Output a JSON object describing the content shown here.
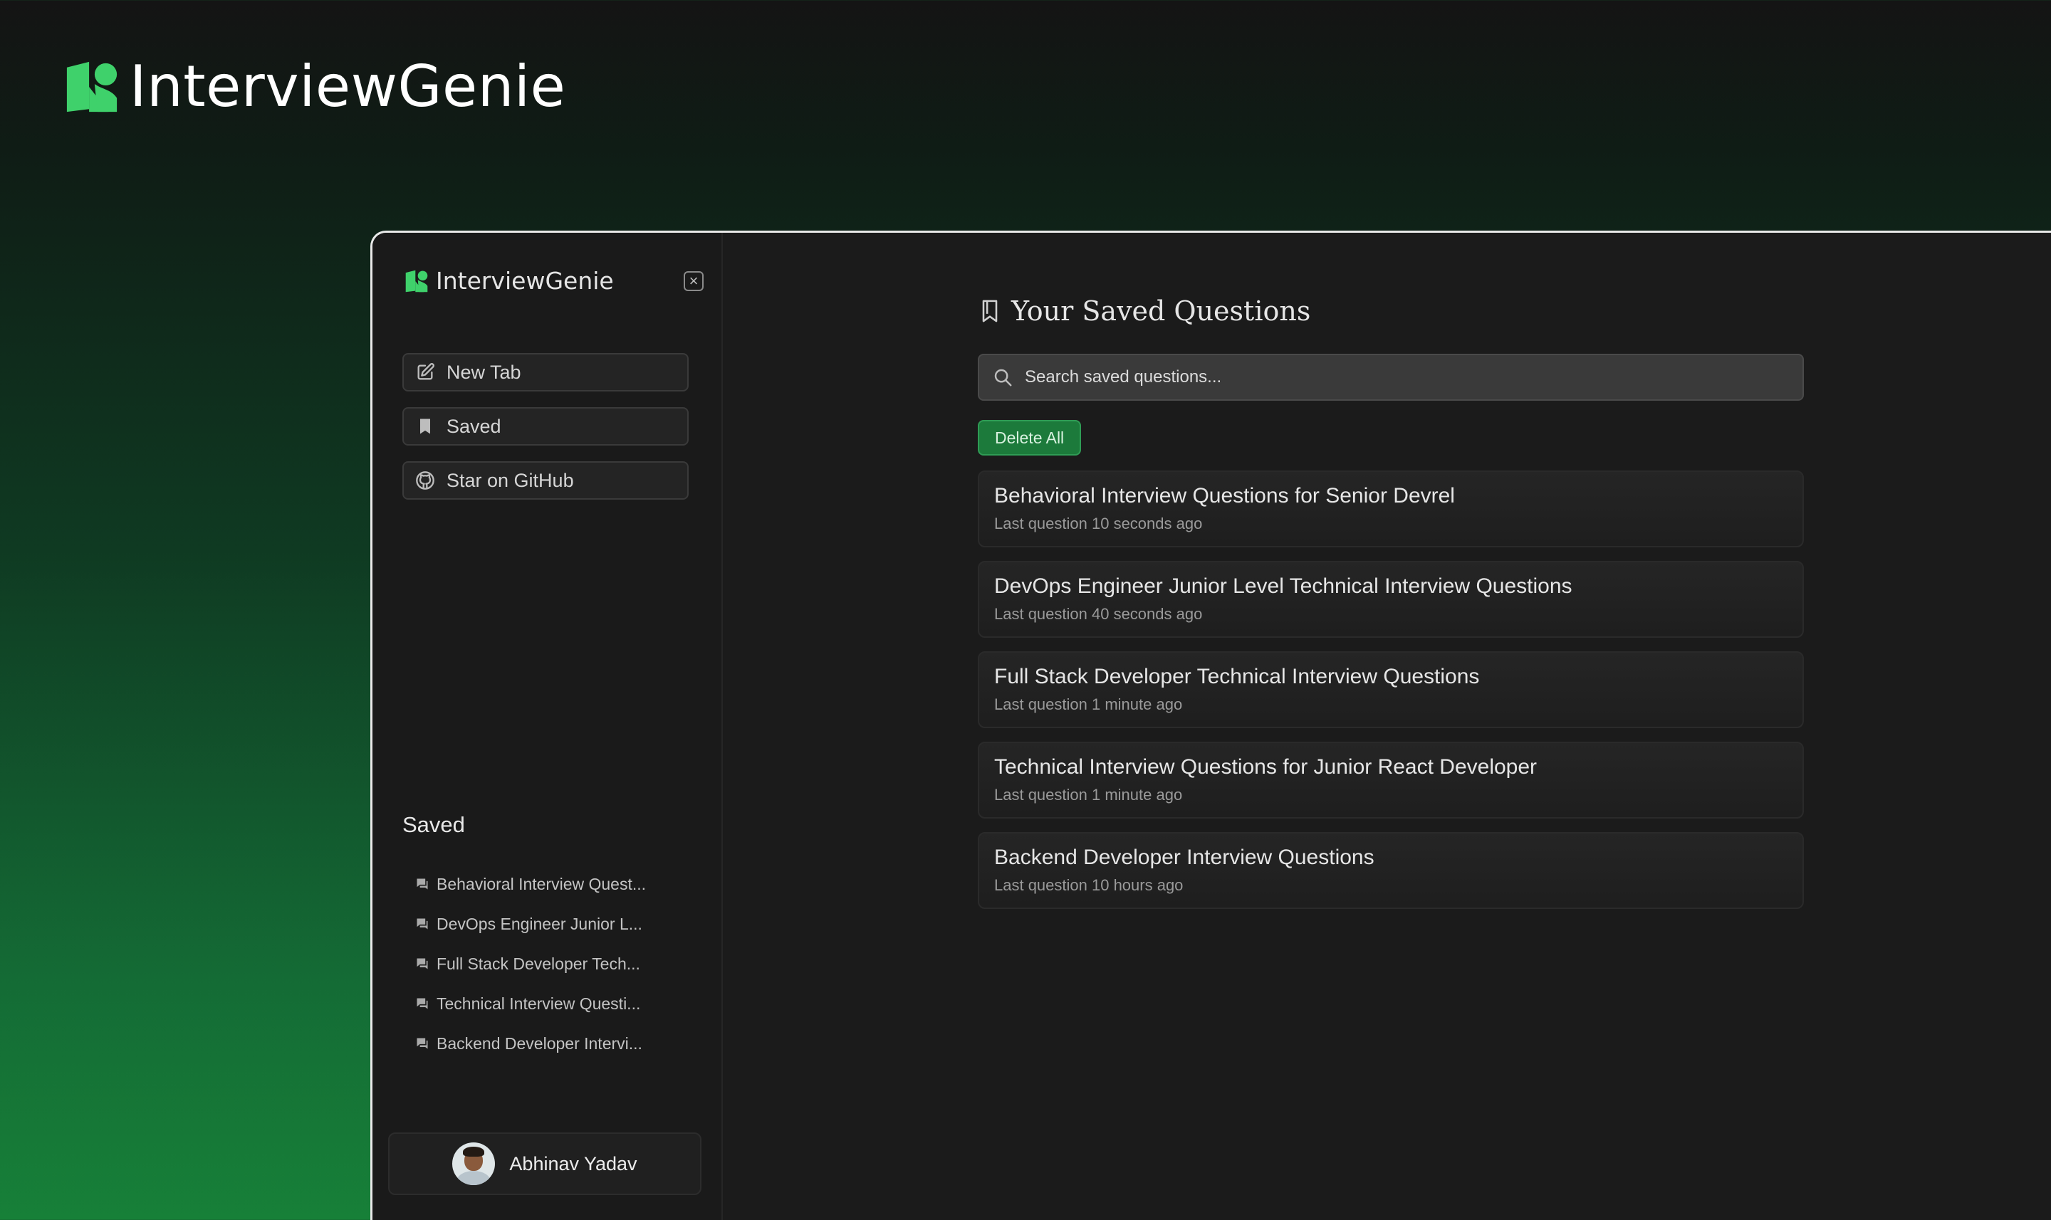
{
  "brand": {
    "name": "InterviewGenie",
    "accent": "#3fd16b"
  },
  "sidebar": {
    "title": "InterviewGenie",
    "close_icon": "close-icon",
    "buttons": [
      {
        "label": "New Tab",
        "icon": "edit-icon"
      },
      {
        "label": "Saved",
        "icon": "bookmark-icon"
      },
      {
        "label": "Star on GitHub",
        "icon": "github-icon"
      }
    ],
    "saved_heading": "Saved",
    "saved_items": [
      {
        "label": "Behavioral Interview Quest..."
      },
      {
        "label": "DevOps Engineer Junior L..."
      },
      {
        "label": "Full Stack Developer Tech..."
      },
      {
        "label": "Technical Interview Questi..."
      },
      {
        "label": "Backend Developer Intervi..."
      }
    ],
    "user": {
      "name": "Abhinav Yadav"
    }
  },
  "main": {
    "title": "Your Saved Questions",
    "search": {
      "placeholder": "Search saved questions...",
      "value": ""
    },
    "delete_all_label": "Delete All",
    "questions": [
      {
        "title": "Behavioral Interview Questions for Senior Devrel",
        "meta": "Last question 10 seconds ago"
      },
      {
        "title": "DevOps Engineer Junior Level Technical Interview Questions",
        "meta": "Last question 40 seconds ago"
      },
      {
        "title": "Full Stack Developer Technical Interview Questions",
        "meta": "Last question 1 minute ago"
      },
      {
        "title": "Technical Interview Questions for Junior React Developer",
        "meta": "Last question 1 minute ago"
      },
      {
        "title": "Backend Developer Interview Questions",
        "meta": "Last question 10 hours ago"
      }
    ]
  }
}
